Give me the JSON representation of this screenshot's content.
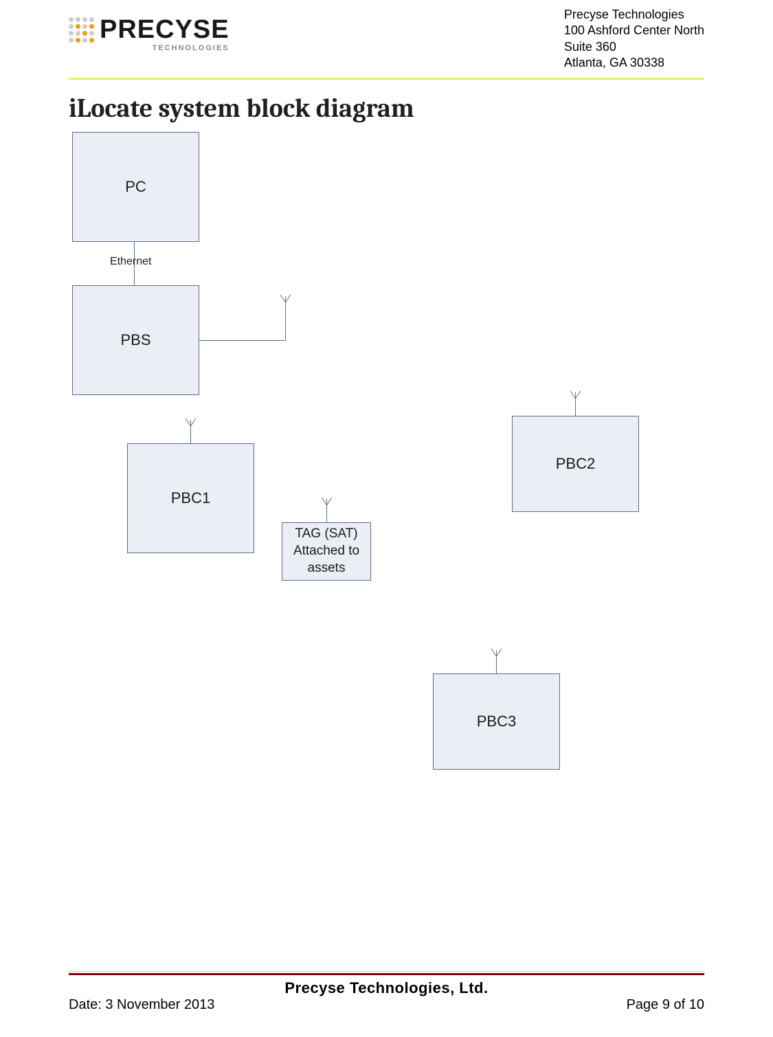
{
  "header": {
    "logo_main": "PRECYSE",
    "logo_sub": "TECHNOLOGIES",
    "address_line1": "Precyse Technologies",
    "address_line2": "100 Ashford Center North",
    "address_line3": "Suite 360",
    "address_line4": "Atlanta, GA  30338"
  },
  "title": "iLocate system block diagram",
  "diagram": {
    "pc": "PC",
    "pbs": "PBS",
    "ethernet": "Ethernet",
    "pbc1": "PBC1",
    "pbc2": "PBC2",
    "pbc3": "PBC3",
    "tag_line1": "TAG (SAT)",
    "tag_line2": "Attached to",
    "tag_line3": "assets"
  },
  "footer": {
    "company": "Precyse Technologies, Ltd.",
    "date": "Date: 3 November 2013",
    "page": "Page 9 of 10"
  }
}
